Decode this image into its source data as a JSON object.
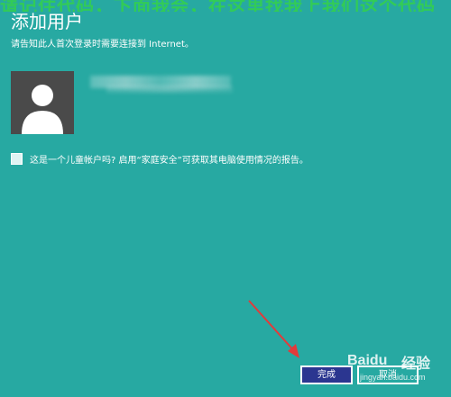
{
  "banner_text": "请记住代码，下面我会，在这里找我上我们这个代码",
  "title": "添加用户",
  "note": "请告知此人首次登录时需要连接到 Internet。",
  "child_account_label": "这是一个儿童帐户吗? 启用“家庭安全”可获取其电脑使用情况的报告。",
  "buttons": {
    "finish": "完成",
    "cancel": "取消"
  },
  "watermark": {
    "logo": "Baidu",
    "cn": "经验",
    "url": "jingyan.baidu.com"
  },
  "colors": {
    "background": "#27a9a2",
    "primary_button": "#2b3690",
    "arrow": "#e23b3b"
  },
  "icons": {
    "avatar": "user-silhouette-icon",
    "arrow": "red-arrow-icon"
  }
}
